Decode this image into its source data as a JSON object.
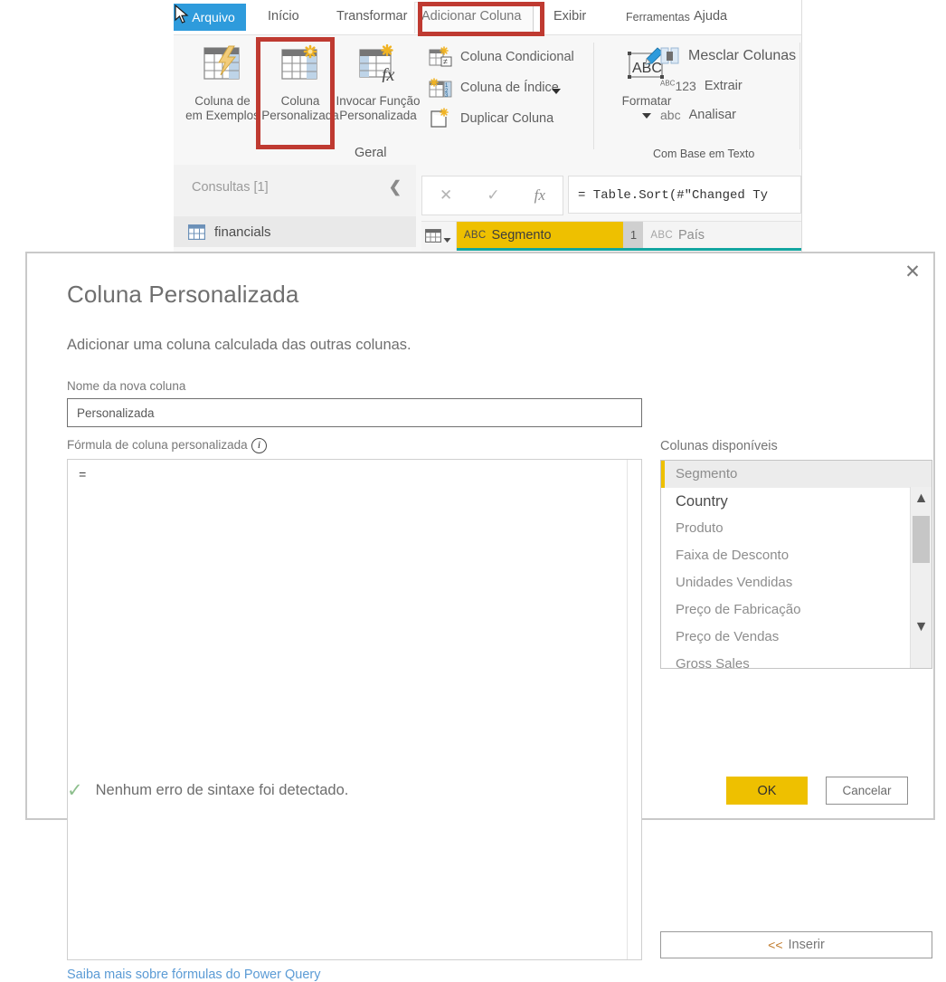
{
  "app": {
    "file_tab": "Arquivo",
    "tabs": [
      {
        "label": "Início"
      },
      {
        "label": "Transformar"
      },
      {
        "label": "Adicionar Coluna"
      },
      {
        "label": "Exibir"
      },
      {
        "label": "Ferramentas"
      },
      {
        "label": "Ajuda"
      }
    ],
    "ribbon": {
      "big_buttons": [
        {
          "line1": "Coluna de",
          "line2": "em Exemplos",
          "icon": "table-lightning-icon"
        },
        {
          "line1": "Coluna",
          "line2": "Personalizada",
          "icon": "table-star-icon"
        },
        {
          "line1": "Invocar Função",
          "line2": "Personalizada",
          "icon": "table-fx-icon"
        },
        {
          "line1": "Formatar",
          "line2": "",
          "icon": "abc-pencil-icon"
        }
      ],
      "small_buttons": [
        {
          "label": "Coluna Condicional",
          "icon": "conditional-column-icon"
        },
        {
          "label": "Coluna de Índice",
          "icon": "index-column-icon"
        },
        {
          "label": "Duplicar Coluna",
          "icon": "duplicate-column-icon"
        },
        {
          "label": "Mesclar Colunas",
          "icon": "merge-columns-icon"
        },
        {
          "label": "Extrair",
          "icon": "123-icon"
        },
        {
          "label": "Analisar",
          "icon": "abc-icon"
        }
      ],
      "group_titles": {
        "general": "Geral",
        "from_text": "Com Base em Texto"
      }
    },
    "queries_pane": {
      "header": "Consultas [1]",
      "collapse_icon": "chevron-left-icon",
      "items": [
        {
          "label": "financials",
          "icon": "table-icon"
        }
      ]
    },
    "formula_bar": {
      "cancel_icon": "x-icon",
      "accept_icon": "check-icon",
      "fx_icon": "fx-icon",
      "value": "= Table.Sort(#\"Changed Ty"
    },
    "table_header": {
      "corner_icon": "table-select-icon",
      "columns": [
        {
          "type": "ABC",
          "name": "Segmento",
          "highlighted": true
        },
        {
          "type": "ABC",
          "name": "País",
          "highlighted": false
        }
      ],
      "sort_order": "1"
    }
  },
  "dialog": {
    "close_icon": "close-icon",
    "title": "Coluna Personalizada",
    "subtitle": "Adicionar uma coluna calculada das outras colunas.",
    "name_label": "Nome da nova coluna",
    "name_value": "Personalizada",
    "name_placeholder": "Personalizada",
    "formula_label": "Fórmula de coluna personalizada",
    "info_icon_glyph": "i",
    "formula_value": "=",
    "learn_link": "Saiba mais sobre fórmulas do Power Query",
    "columns_label": "Colunas disponíveis",
    "available_columns": [
      {
        "name": "Segmento",
        "state": "selected"
      },
      {
        "name": "Country",
        "state": "focused"
      },
      {
        "name": "Produto",
        "state": "normal"
      },
      {
        "name": "Faixa de Desconto",
        "state": "normal"
      },
      {
        "name": "Unidades Vendidas",
        "state": "normal"
      },
      {
        "name": "Preço de Fabricação",
        "state": "normal"
      },
      {
        "name": "Preço de Vendas",
        "state": "normal"
      },
      {
        "name": "Gross Sales",
        "state": "normal"
      }
    ],
    "scroll_up_icon": "chevron-up-icon",
    "scroll_down_icon": "chevron-down-icon",
    "insert_button": "Inserir",
    "insert_chevrons": "<<",
    "status_icon": "green-check-icon",
    "status_text": "Nenhum erro de sintaxe foi detectado.",
    "ok_label": "OK",
    "cancel_label": "Cancelar"
  },
  "annotations": {
    "color": "#bf3a31",
    "boxes": [
      {
        "name": "adicionar-coluna-tab"
      },
      {
        "name": "coluna-personalizada-button"
      }
    ]
  }
}
